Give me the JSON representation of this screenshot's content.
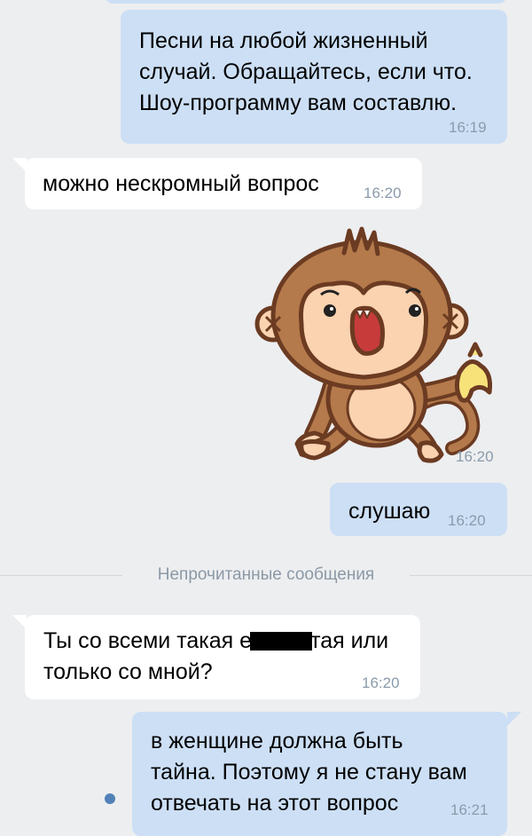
{
  "messages": [
    {
      "direction": "out",
      "text": "Песни на любой жизненный\nслучай. Обращайтесь, если что.\nШоу-программу вам составлю.",
      "time": "16:19"
    },
    {
      "direction": "in",
      "text": "можно нескромный вопрос",
      "time": "16:20"
    },
    {
      "direction": "out",
      "type": "sticker",
      "sticker": "monkey-banana-sticker",
      "time": "16:20"
    },
    {
      "direction": "out",
      "text": "слушаю",
      "time": "16:20"
    },
    {
      "direction": "in",
      "text_before": "Ты со всеми такая е",
      "text_after": "тая или\nтолько со мной?",
      "censored": true,
      "time": "16:20"
    },
    {
      "direction": "out",
      "text": "в женщине должна быть\nтайна. Поэтому я не стану вам\nотвечать на этот вопрос",
      "time": "16:21",
      "unread": true
    }
  ],
  "divider": {
    "label": "Непрочитанные сообщения"
  },
  "colors": {
    "background": "#edeef0",
    "outgoing_bubble": "#ccdff5",
    "incoming_bubble": "#ffffff",
    "time_text": "#8a9bab",
    "unread_dot": "#5181b8"
  }
}
